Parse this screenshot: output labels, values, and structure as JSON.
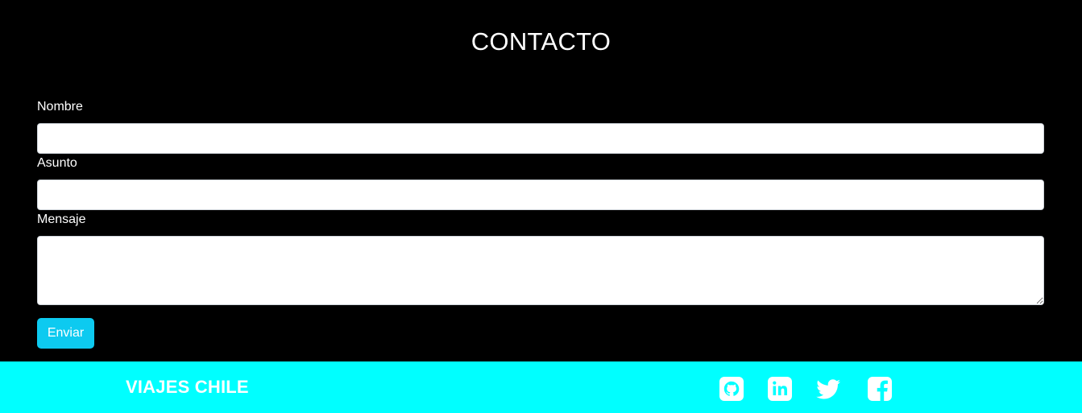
{
  "contact": {
    "title": "CONTACTO",
    "fields": {
      "name_label": "Nombre",
      "name_value": "",
      "subject_label": "Asunto",
      "subject_value": "",
      "message_label": "Mensaje",
      "message_value": ""
    },
    "submit_label": "Enviar"
  },
  "footer": {
    "brand": "VIAJES CHILE",
    "social": [
      {
        "icon": "github-icon"
      },
      {
        "icon": "linkedin-icon"
      },
      {
        "icon": "twitter-icon"
      },
      {
        "icon": "facebook-icon"
      }
    ]
  },
  "colors": {
    "background": "#000000",
    "footer": "#00ffff",
    "button": "#0dcaf0",
    "text": "#ffffff"
  }
}
